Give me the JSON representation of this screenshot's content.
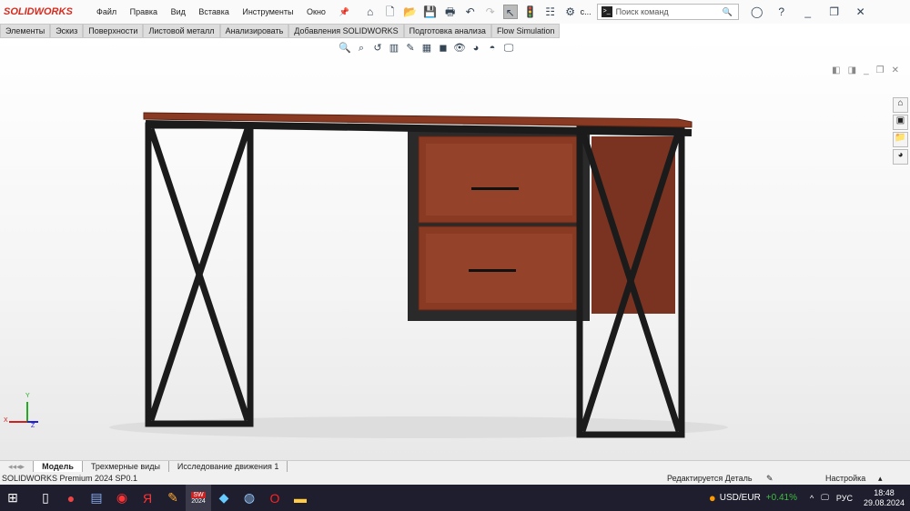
{
  "app": {
    "logo": "SOLIDWORKS"
  },
  "menu": [
    "Файл",
    "Правка",
    "Вид",
    "Вставка",
    "Инструменты",
    "Окно"
  ],
  "search": {
    "placeholder": "Поиск команд"
  },
  "overflow": "c...",
  "tabs": [
    "Элементы",
    "Эскиз",
    "Поверхности",
    "Листовой металл",
    "Анализировать",
    "Добавления SOLIDWORKS",
    "Подготовка анализа",
    "Flow Simulation"
  ],
  "bottom_tabs": [
    "Модель",
    "Трехмерные виды",
    "Исследование движения 1"
  ],
  "status": {
    "version": "SOLIDWORKS Premium 2024 SP0.1",
    "mode": "Редактируется Деталь",
    "settings": "Настройка"
  },
  "triad": {
    "x": "X",
    "y": "Y",
    "z": "Z"
  },
  "taskbar": {
    "ticker": "USD/EUR",
    "change": "+0.41%",
    "lang": "РУС",
    "time": "18:48",
    "date": "29.08.2024",
    "sw_badge": "2024"
  },
  "colors": {
    "accent": "#d52b1e",
    "wood": "#8a3a22",
    "frame": "#1b1b1b",
    "positive": "#3fbf3f"
  }
}
